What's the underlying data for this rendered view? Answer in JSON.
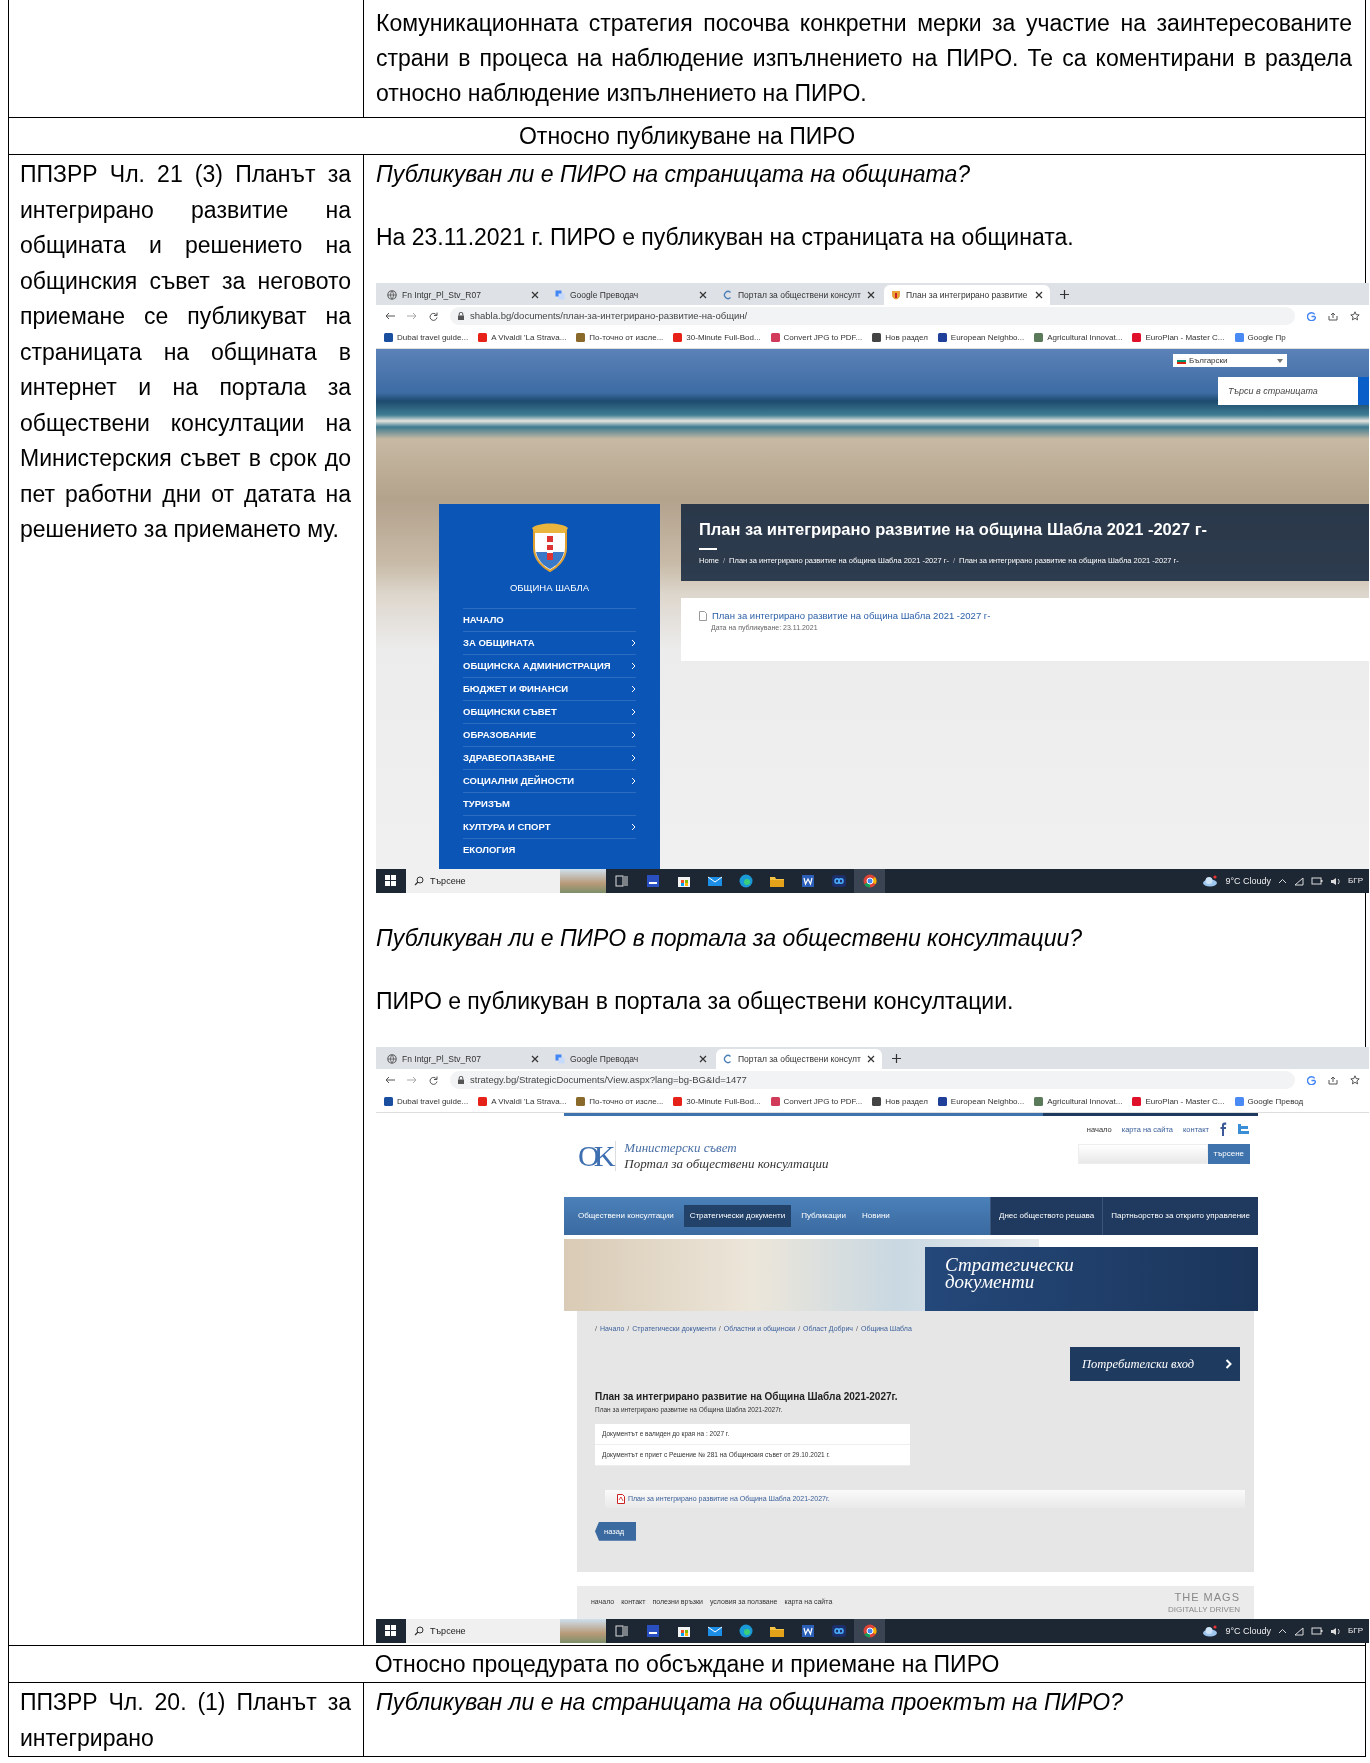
{
  "table": {
    "rows": [
      {
        "kind": "content",
        "right": [
          {
            "kind": "paragraph",
            "text": "Комуникационната стратегия посочва конкретни мерки за участие на заинтересованите страни в процеса на наблюдение изпълнението на ПИРО. Те са коментирани в раздела относно наблюдение изпълнението на ПИРО."
          }
        ]
      },
      {
        "kind": "heading",
        "text": "Относно публикуване на ПИРО"
      },
      {
        "kind": "content",
        "left": "ППЗРР Чл. 21 (3) Планът за интегрирано развитие на общината и решението на общинския съвет за неговото приемане се публикуват на страницата на общината в интернет и на портала за обществени консултации на Министерския съвет в срок до пет работни дни от датата на решението за приемането му.",
        "right": [
          {
            "kind": "question",
            "text": "Публикуван ли е ПИРО на страницата на общината?"
          },
          {
            "kind": "paragraph",
            "text": "На 23.11.2021 г. ПИРО е публикуван на страницата на общината."
          },
          {
            "kind": "screenshot",
            "browser": {
              "tabs": [
                {
                  "title": "Fn Intgr_Pl_Stv_R07",
                  "selected": false
                },
                {
                  "title": "Google Преводач",
                  "selected": false
                },
                {
                  "title": "Портал за обществени консулт",
                  "selected": false
                },
                {
                  "title": "План за интегрирано развитие",
                  "selected": true
                }
              ],
              "address": "shabla.bg/documents/план-за-интегрирано-развитие-на-общин/",
              "bookmarks": [
                {
                  "label": "Dubai travel guide...",
                  "color": "#1a4fa0"
                },
                {
                  "label": "A Vivaldi 'La Strava...",
                  "color": "#e62117"
                },
                {
                  "label": "По-точно от изсле...",
                  "color": "#8a6a2a"
                },
                {
                  "label": "30-Minute Full-Bod...",
                  "color": "#e62117"
                },
                {
                  "label": "Convert JPG to PDF...",
                  "color": "#d23a5a"
                },
                {
                  "label": "Нов раздел",
                  "color": "#444444"
                },
                {
                  "label": "European Neighbo...",
                  "color": "#1f3f99"
                },
                {
                  "label": "Agricultural Innovat...",
                  "color": "#5a7a5a"
                },
                {
                  "label": "EuroPlan - Master C...",
                  "color": "#e0102a"
                },
                {
                  "label": "Google Пр",
                  "color": "#4a8af4"
                }
              ]
            },
            "site": {
              "kind": "municipality",
              "language": "Български",
              "search": {
                "placeholder": "Търси в страницата"
              },
              "logo_caption": "ОБЩИНА ШАБЛА",
              "menu": [
                {
                  "label": "НАЧАЛО",
                  "has_submenu": false
                },
                {
                  "label": "ЗА ОБЩИНАТА",
                  "has_submenu": true
                },
                {
                  "label": "ОБЩИНСКА АДМИНИСТРАЦИЯ",
                  "has_submenu": true
                },
                {
                  "label": "БЮДЖЕТ И ФИНАНСИ",
                  "has_submenu": true
                },
                {
                  "label": "ОБЩИНСКИ СЪВЕТ",
                  "has_submenu": true
                },
                {
                  "label": "ОБРАЗОВАНИЕ",
                  "has_submenu": true
                },
                {
                  "label": "ЗДРАВЕОПАЗВАНЕ",
                  "has_submenu": true
                },
                {
                  "label": "СОЦИАЛНИ ДЕЙНОСТИ",
                  "has_submenu": true
                },
                {
                  "label": "ТУРИЗЪМ",
                  "has_submenu": false
                },
                {
                  "label": "КУЛТУРА И СПОРТ",
                  "has_submenu": true
                },
                {
                  "label": "ЕКОЛОГИЯ",
                  "has_submenu": false
                }
              ],
              "title": "План за интегрирано развитие на община Шабла 2021 -2027 г-",
              "breadcrumb_separator": "/",
              "breadcrumb": [
                "Home",
                "План за интегрирано развитие на община Шабла 2021 -2027 г-",
                "План за интегрирано развитие на община Шабла 2021 -2027 г-"
              ],
              "document": {
                "link": "План за интегрирано развитие на община Шабла 2021 -2027 г-",
                "date": "Дата на публикуване: 23.11.2021"
              }
            },
            "taskbar": {
              "search": "Търсене",
              "weather": "9°C Cloudy",
              "language": "БГР"
            }
          },
          {
            "kind": "question",
            "text": "Публикуван ли е ПИРО в портала за обществени консултации?"
          },
          {
            "kind": "paragraph",
            "text": "ПИРО е публикуван в портала за обществени консултации."
          },
          {
            "kind": "screenshot",
            "browser": {
              "tabs": [
                {
                  "title": "Fn Intgr_Pl_Stv_R07",
                  "selected": false
                },
                {
                  "title": "Google Преводач",
                  "selected": false
                },
                {
                  "title": "Портал за обществени консулт",
                  "selected": true
                }
              ],
              "address": "strategy.bg/StrategicDocuments/View.aspx?lang=bg-BG&Id=1477",
              "bookmarks": [
                {
                  "label": "Dubai travel guide...",
                  "color": "#1a4fa0"
                },
                {
                  "label": "A Vivaldi 'La Strava...",
                  "color": "#e62117"
                },
                {
                  "label": "По-точно от изсле...",
                  "color": "#8a6a2a"
                },
                {
                  "label": "30-Minute Full-Bod...",
                  "color": "#e62117"
                },
                {
                  "label": "Convert JPG to PDF...",
                  "color": "#d23a5a"
                },
                {
                  "label": "Нов раздел",
                  "color": "#444444"
                },
                {
                  "label": "European Neighbo...",
                  "color": "#1f3f99"
                },
                {
                  "label": "Agricultural Innovat...",
                  "color": "#5a7a5a"
                },
                {
                  "label": "EuroPlan - Master C...",
                  "color": "#e0102a"
                },
                {
                  "label": "Google Превод",
                  "color": "#4a8af4"
                }
              ]
            },
            "site": {
              "kind": "portal",
              "top_links": [
                "начало",
                "карта на сайта",
                "контакт"
              ],
              "logo_mark": "OK",
              "logo_title": "Министерски съвет",
              "logo_subtitle": "Портал за обществени консултации",
              "search_button": "търсене",
              "nav": [
                {
                  "label": "Обществени консултации",
                  "selected": false
                },
                {
                  "label": "Стратегически документи",
                  "selected": true
                },
                {
                  "label": "Публикации",
                  "selected": false
                },
                {
                  "label": "Новини",
                  "selected": false
                }
              ],
              "nav_secondary": [
                "Днес обществото решава",
                "Партньорство за открито управление"
              ],
              "banner_title": "Стратегически документи",
              "breadcrumb_separator": "/",
              "breadcrumb": [
                "Начало",
                "Стратегически документи",
                "Областни и общински",
                "Област Добрич",
                "Община Шабла"
              ],
              "login_button": "Потребителски вход",
              "document": {
                "title": "План за интегрирано развитие на Община Шабла 2021-2027г.",
                "subtitle": "План за интегрирано развитие на Община Шабла 2021-2027г.",
                "details": [
                  "Документът е валиден до края на : 2027 г.",
                  "Документът е приет с Решение № 281 на Общинския съвет от 29.10.2021 г."
                ],
                "file_link": "План за интегрирано развитие на Община Шабла 2021-2027г.",
                "back_button": "назад"
              },
              "footer_links": [
                "начало",
                "контакт",
                "полезни връзки",
                "условия за ползване",
                "карта на сайта"
              ],
              "footer_logo": "THE MAGS",
              "footer_tagline": "DIGITALLY DRIVEN"
            },
            "taskbar": {
              "search": "Търсене",
              "weather": "9°C Cloudy",
              "language": "БГР"
            }
          }
        ]
      },
      {
        "kind": "heading",
        "text": "Относно процедурата по обсъждане и приемане на ПИРО"
      },
      {
        "kind": "content",
        "left": "ППЗРР Чл. 20. (1) Планът за интегрирано",
        "right": [
          {
            "kind": "question",
            "text": "Публикуван ли е на страницата на общината проектът на ПИРО?"
          }
        ]
      }
    ]
  }
}
